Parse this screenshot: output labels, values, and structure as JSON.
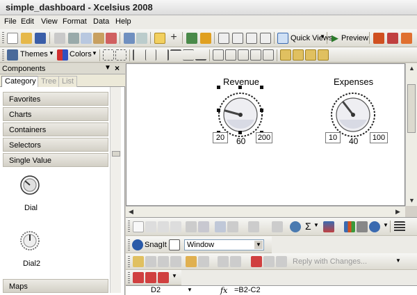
{
  "window": {
    "title": "simple_dashboard - Xcelsius 2008"
  },
  "menu": [
    "File",
    "Edit",
    "View",
    "Format",
    "Data",
    "Help"
  ],
  "toolbar": {
    "quick_views": "Quick Views",
    "preview": "Preview",
    "themes": "Themes",
    "colors": "Colors"
  },
  "components_panel": {
    "title": "Components",
    "tabs": [
      "Category",
      "Tree",
      "List"
    ],
    "categories": [
      "Favorites",
      "Charts",
      "Containers",
      "Selectors",
      "Single Value"
    ],
    "items": [
      "Dial",
      "Dial2"
    ],
    "footer_category": "Maps"
  },
  "canvas": {
    "dials": [
      {
        "title": "Revenue",
        "min": "20",
        "value": "60",
        "max": "200"
      },
      {
        "title": "Expenses",
        "min": "10",
        "value": "40",
        "max": "100"
      }
    ]
  },
  "spreadsheet": {
    "snagit": "SnagIt",
    "snagit_target": "Window",
    "reply": "Reply with Changes...",
    "cell_ref": "D2",
    "fx": "fx",
    "formula": "=B2-C2"
  },
  "colors": {
    "accent_blue": "#2a5aa8",
    "canvas_bg": "#ffffff",
    "chrome": "#d4d0c8"
  }
}
